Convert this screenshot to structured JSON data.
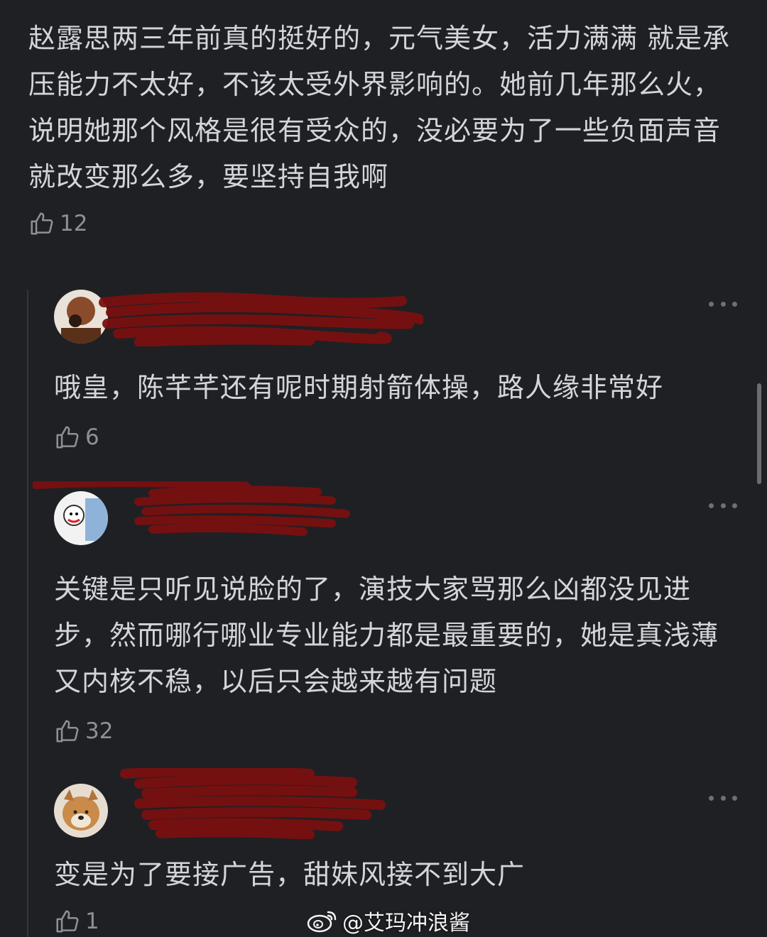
{
  "main_comment": {
    "text": "赵露思两三年前真的挺好的，元气美女，活力满满 就是承压能力不太好，不该太受外界影响的。她前几年那么火，说明她那个风格是很有受众的，没必要为了一些负面声音就改变那么多，要坚持自我啊",
    "likes": "12"
  },
  "replies": [
    {
      "text": "哦皇，陈芊芊还有呢时期射箭体操，路人缘非常好",
      "likes": "6"
    },
    {
      "text": "关键是只听见说脸的了，演技大家骂那么凶都没见进步，然而哪行哪业专业能力都是最重要的，她是真浅薄又内核不稳，以后只会越来越有问题",
      "likes": "32"
    },
    {
      "text": "变是为了要接广告，甜妹风接不到大广",
      "likes": "1"
    }
  ],
  "watermark": {
    "text": "@艾玛冲浪酱"
  },
  "icons": {
    "like": "thumbs-up-icon",
    "more": "more-dots-icon",
    "weibo": "weibo-logo-icon"
  },
  "colors": {
    "background": "#1f2024",
    "text": "#d4d5d9",
    "muted": "#8f9096",
    "redaction": "#7a1010"
  }
}
